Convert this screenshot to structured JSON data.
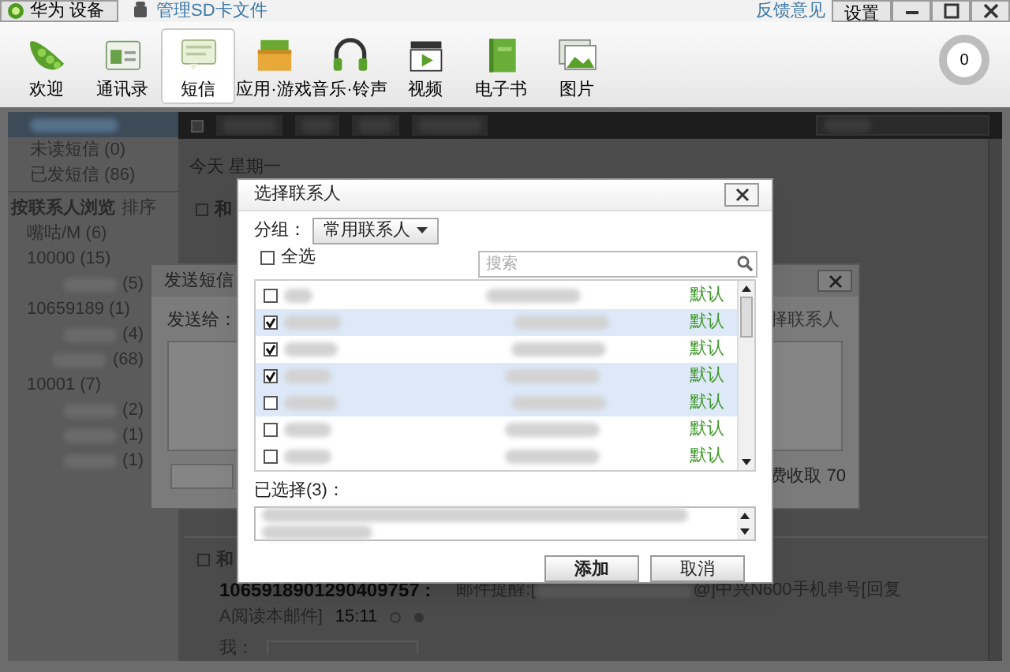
{
  "top_bar": {
    "device_tab": "华为 设备",
    "sd_link": "管理SD卡文件",
    "feedback_link": "反馈意见",
    "settings_button": "设置"
  },
  "nav": [
    {
      "label": "欢迎",
      "selected": false
    },
    {
      "label": "通讯录",
      "selected": false
    },
    {
      "label": "短信",
      "selected": true
    },
    {
      "label": "应用·游戏",
      "selected": false
    },
    {
      "label": "音乐·铃声",
      "selected": false
    },
    {
      "label": "视频",
      "selected": false
    },
    {
      "label": "电子书",
      "selected": false
    },
    {
      "label": "图片",
      "selected": false
    }
  ],
  "task_badge": "0",
  "sidebar": {
    "items": [
      {
        "selected": true
      },
      {
        "label": "未读短信 (0)",
        "selected": false
      },
      {
        "label": "已发短信 (86)",
        "selected": false
      }
    ],
    "group_header": "按联系人浏览",
    "sort_label": "排序",
    "contacts": [
      {
        "text": "嘴咕/M (6)",
        "blurred": false
      },
      {
        "text": "10000 (15)",
        "blurred": false
      },
      {
        "text": "(5)",
        "blurred": true
      },
      {
        "text": "10659189   (1)",
        "blurred": false
      },
      {
        "text": "(4)",
        "blurred": true
      },
      {
        "text": "(68)",
        "blurred": true
      },
      {
        "text": "10001 (7)",
        "blurred": false
      },
      {
        "text": "(2)",
        "blurred": true
      },
      {
        "text": "(1)",
        "blurred": true
      },
      {
        "text": "(1)",
        "blurred": true
      }
    ]
  },
  "toolbar": {
    "select_all_checked": false
  },
  "messages": {
    "date_header": "今天 星期一",
    "first_sender": "和",
    "first_checked": false,
    "second": {
      "sender": "和",
      "checked": false,
      "number": "1065918901290409757 :",
      "body_start": "邮件提醒:[",
      "body_end": "@]中兴N600手机串号[回复",
      "body_line2": "A阅读本邮件]",
      "time": "15:11",
      "reply_label": "我："
    }
  },
  "send_dialog": {
    "title": "发送短信",
    "to_label": "发送给：",
    "pick_link": "择联系人",
    "fee_note": "费收取 70"
  },
  "picker": {
    "title": "选择联系人",
    "group_label": "分组：",
    "group_value": "常用联系人",
    "select_all": {
      "label": "全选",
      "checked": false
    },
    "search": {
      "placeholder": "搜索"
    },
    "rows": [
      {
        "checked": false,
        "shaded": false,
        "tag": "默认"
      },
      {
        "checked": true,
        "shaded": true,
        "tag": "默认"
      },
      {
        "checked": true,
        "shaded": false,
        "tag": "默认"
      },
      {
        "checked": true,
        "shaded": true,
        "tag": "默认"
      },
      {
        "checked": false,
        "shaded": true,
        "tag": "默认"
      },
      {
        "checked": false,
        "shaded": false,
        "tag": "默认"
      },
      {
        "checked": false,
        "shaded": false,
        "tag": "默认"
      }
    ],
    "selected_label": "已选择(3)：",
    "buttons": [
      "添加",
      "取消"
    ]
  }
}
